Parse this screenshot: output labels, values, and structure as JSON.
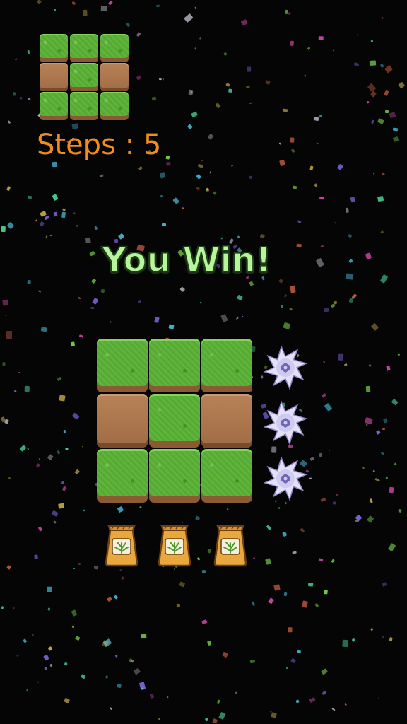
{
  "hud": {
    "steps_text": "Steps : 5"
  },
  "result": {
    "title": "You Win!"
  },
  "target_pattern": [
    [
      "grass",
      "grass",
      "grass"
    ],
    [
      "dirt",
      "grass",
      "dirt"
    ],
    [
      "grass",
      "grass",
      "grass"
    ]
  ],
  "board": [
    [
      "grass",
      "grass",
      "grass"
    ],
    [
      "dirt",
      "grass",
      "dirt"
    ],
    [
      "grass",
      "grass",
      "grass"
    ]
  ],
  "row_tools": [
    "saw-blade-icon",
    "saw-blade-icon",
    "saw-blade-icon"
  ],
  "column_tools": [
    "seed-bag-icon",
    "seed-bag-icon",
    "seed-bag-icon"
  ],
  "colors": {
    "steps": "#f28d1c",
    "win_text": "#b6f599",
    "grass": "#5fb53a",
    "dirt": "#b88258",
    "background": "#050505"
  }
}
